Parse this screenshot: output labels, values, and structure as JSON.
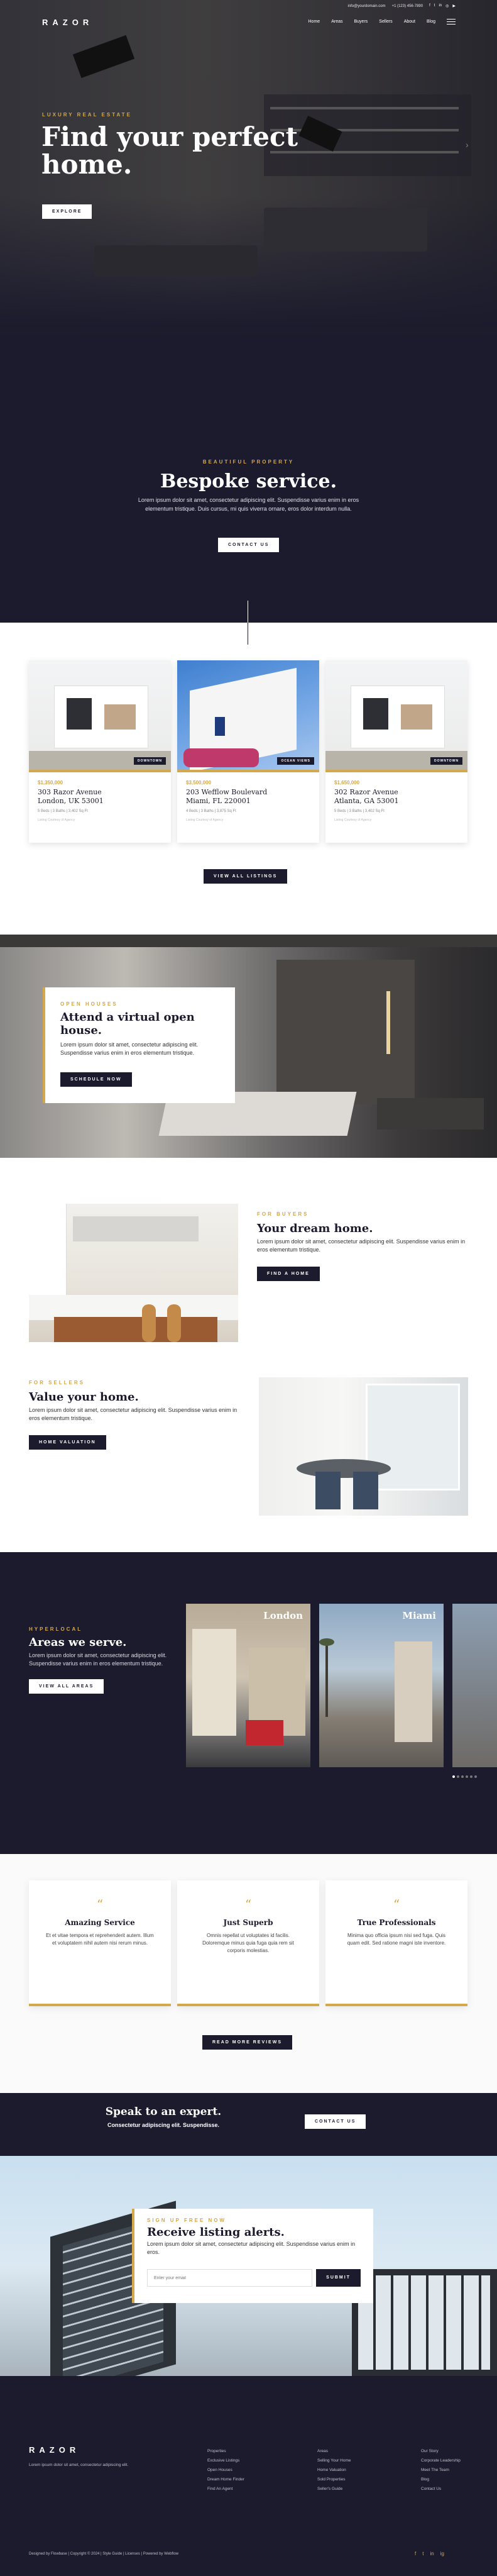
{
  "header": {
    "logo": "RAZOR",
    "email": "info@yourdomain.com",
    "phone": "+1 (123) 456-7890",
    "menu": [
      "Home",
      "Areas",
      "Buyers",
      "Sellers",
      "About",
      "Blog"
    ]
  },
  "hero": {
    "eyebrow": "LUXURY REAL ESTATE",
    "title_line1": "Find your perfect",
    "title_line2": "home.",
    "button": "EXPLORE"
  },
  "service": {
    "eyebrow": "BEAUTIFUL PROPERTY",
    "title": "Bespoke service.",
    "text_line1": "Lorem ipsum dolor sit amet, consectetur adipiscing elit. Suspendisse varius enim in eros",
    "text_line2": "elementum tristique. Duis cursus, mi quis viverra ornare, eros dolor interdum nulla.",
    "button": "CONTACT US"
  },
  "listings": [
    {
      "price": "$1,350,000",
      "addr1": "303 Razor Avenue",
      "addr2": "London, UK 53001",
      "meta": "5 Beds | 3 Baths | 3,402 Sq Ft",
      "tag": "DOWNTOWN",
      "note": "Listing Courtesy of Agency"
    },
    {
      "price": "$3,500,000",
      "addr1": "203 Wefflow Boulevard",
      "addr2": "Miami, FL 220001",
      "meta": "4 Beds | 3 Baths | 3,875 Sq Ft",
      "tag": "OCEAN VIEWS",
      "note": "Listing Courtesy of Agency"
    },
    {
      "price": "$1,650,000",
      "addr1": "302 Razor Avenue",
      "addr2": "Atlanta, GA 53001",
      "meta": "5 Beds | 3 Baths | 3,402 Sq Ft",
      "tag": "DOWNTOWN",
      "note": "Listing Courtesy of Agency"
    }
  ],
  "listings_button": "VIEW ALL LISTINGS",
  "open_house": {
    "eyebrow": "OPEN HOUSES",
    "title": "Attend a virtual open house.",
    "text": "Lorem ipsum dolor sit amet, consectetur adipiscing elit. Suspendisse varius enim in eros elementum tristique.",
    "button": "SCHEDULE NOW"
  },
  "buyers": {
    "eyebrow": "FOR BUYERS",
    "title": "Your dream home.",
    "text": "Lorem ipsum dolor sit amet, consectetur adipiscing elit. Suspendisse varius enim in eros elementum tristique.",
    "button": "FIND A HOME"
  },
  "sellers": {
    "eyebrow": "FOR SELLERS",
    "title": "Value your home.",
    "text": "Lorem ipsum dolor sit amet, consectetur adipiscing elit. Suspendisse varius enim in eros elementum tristique.",
    "button": "HOME VALUATION"
  },
  "areas": {
    "eyebrow": "HYPERLOCAL",
    "title": "Areas we serve.",
    "text": "Lorem ipsum dolor sit amet, consectetur adipiscing elit. Suspendisse varius enim in eros elementum tristique.",
    "button": "VIEW ALL AREAS",
    "cities": [
      "London",
      "Miami"
    ]
  },
  "testimonials": [
    {
      "title": "Amazing Service",
      "text": "Et et vitae tempora et reprehenderit autem. Illum et voluptatem nihil autem nisi rerum minus."
    },
    {
      "title": "Just Superb",
      "text": "Omnis repellat ut voluptates id facilis. Doloremque minus quia fuga quia rem sit corporis molestias."
    },
    {
      "title": "True Professionals",
      "text": "Minima quo officia ipsum nisi sed fuga. Quis quam edit. Sed ratione magni iste inventore."
    }
  ],
  "reviews_button": "READ MORE REVIEWS",
  "expert": {
    "title": "Speak to an expert.",
    "text": "Consectetur adipiscing elit. Suspendisse.",
    "button": "CONTACT US"
  },
  "alerts": {
    "eyebrow": "SIGN UP FREE NOW",
    "title": "Receive listing alerts.",
    "text": "Lorem ipsum dolor sit amet, consectetur adipiscing elit. Suspendisse varius enim in eros.",
    "placeholder": "Enter your email",
    "button": "SUBMIT"
  },
  "footer": {
    "logo": "RAZOR",
    "tagline": "Lorem ipsum dolor sit amet, consectetur adipiscing elit.",
    "col1": [
      "Properties",
      "Exclusive Listings",
      "Open Houses",
      "Dream Home Finder",
      "Find An Agent"
    ],
    "col2": [
      "Areas",
      "Selling Your Home",
      "Home Valuation",
      "Sold Properties",
      "Seller's Guide"
    ],
    "col3": [
      "Our Story",
      "Corporate Leadership",
      "Meet The Team",
      "Blog",
      "Contact Us"
    ],
    "copyright": "Designed by Flowbase | Copyright © 2024 | Style Guide | Licenses | Powered by Webflow",
    "social": [
      "f",
      "t",
      "in",
      "ig"
    ]
  },
  "colors": {
    "navy": "#1c1b2d",
    "gold": "#d4a84b"
  }
}
